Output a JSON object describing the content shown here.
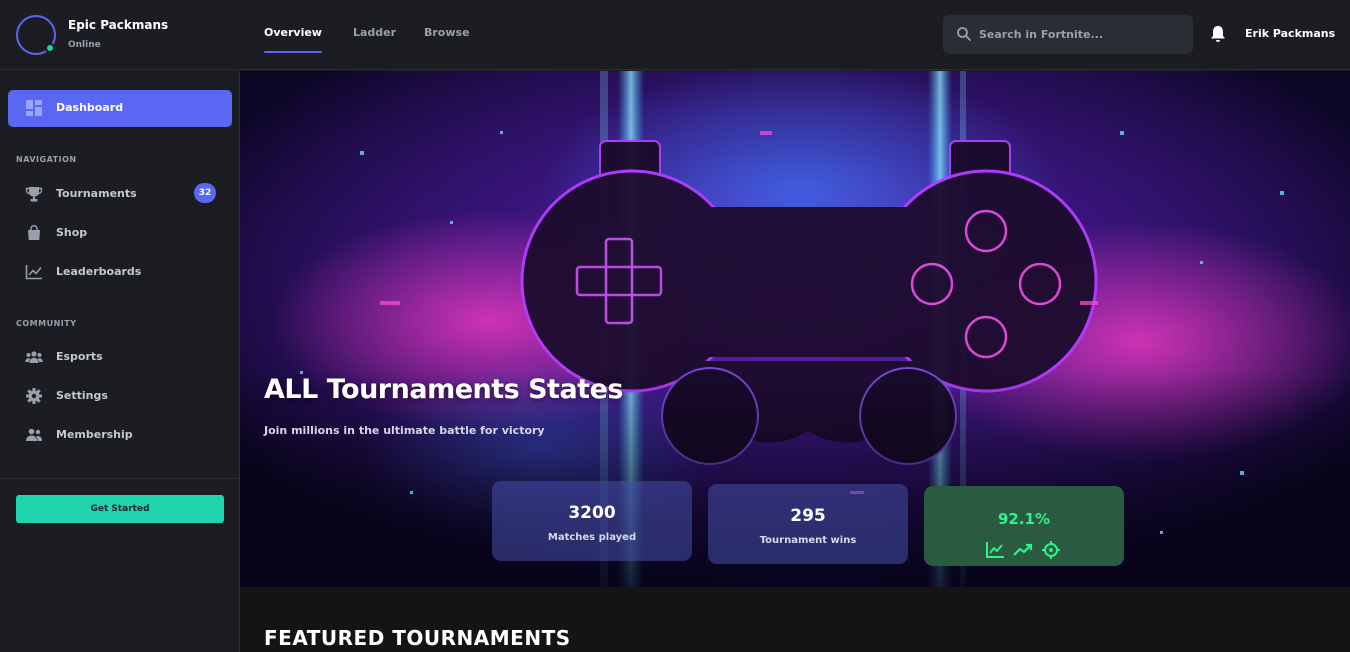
{
  "profile": {
    "name": "Epic Packmans",
    "status": "Online"
  },
  "nav": {
    "tabs": [
      {
        "label": "Overview"
      },
      {
        "label": "Ladder"
      },
      {
        "label": "Browse"
      }
    ]
  },
  "search": {
    "placeholder": "Search in Fortnite..."
  },
  "user": {
    "name": "Erik Packmans"
  },
  "sidebar": {
    "dashboard_label": "Dashboard",
    "navigation_title": "NAVIGATION",
    "navigation_items": [
      {
        "label": "Tournaments",
        "icon": "trophy-icon",
        "badge": "32"
      },
      {
        "label": "Shop",
        "icon": "shopping-bag-icon"
      },
      {
        "label": "Leaderboards",
        "icon": "chart-line-icon"
      }
    ],
    "community_title": "COMMUNITY",
    "community_items": [
      {
        "label": "Esports",
        "icon": "users-icon"
      },
      {
        "label": "Settings",
        "icon": "gear-icon"
      },
      {
        "label": "Membership",
        "icon": "user-group-icon"
      }
    ],
    "cta_label": "Get Started"
  },
  "hero": {
    "title": "ALL Tournaments States",
    "subtitle": "Join millions in the ultimate battle for victory",
    "stats": [
      {
        "value": "3200",
        "label": "Matches played"
      },
      {
        "value": "295",
        "label": "Tournament wins"
      },
      {
        "value": "92.1%",
        "icons": [
          "chart-line-icon",
          "trending-up-icon",
          "crosshair-icon"
        ]
      }
    ]
  },
  "featured": {
    "title": "FEATURED TOURNAMENTS"
  },
  "colors": {
    "accent": "#5a67f2",
    "success": "#1fd39a",
    "cta": "#1fd3ad",
    "background": "#1b1d23"
  }
}
